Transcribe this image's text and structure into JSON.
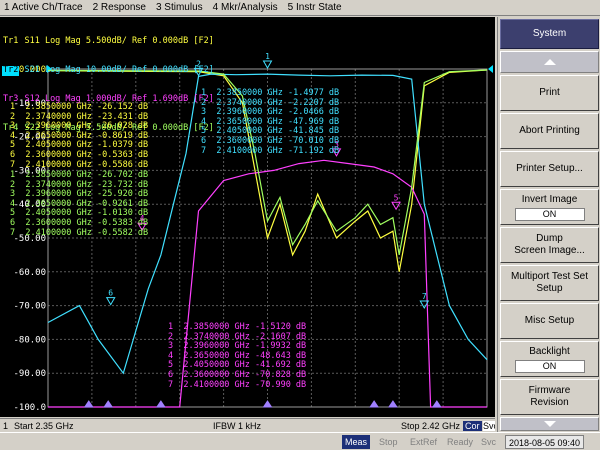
{
  "menu": [
    {
      "num": "1",
      "label": "Active Ch/Trace"
    },
    {
      "num": "2",
      "label": "Response"
    },
    {
      "num": "3",
      "label": "Stimulus"
    },
    {
      "num": "4",
      "label": "Mkr/Analysis"
    },
    {
      "num": "5",
      "label": "Instr State"
    }
  ],
  "traces": [
    {
      "id": "Tr1",
      "text": " S11 Log Mag 5.500dB/ Ref 0.000dB [F2]",
      "color": "#ffff40",
      "active": false
    },
    {
      "id": "Tr2",
      "text": " S21 Log Mag 10.00dB/ Ref 0.000dB [F2]",
      "color": "#40e0ff",
      "active": true
    },
    {
      "id": "Tr3",
      "text": " S12 Log Mag 1.000dB/ Ref 1.690dB [F2]",
      "color": "#ff40ff",
      "active": false
    },
    {
      "id": "Tr4",
      "text": " S22 Log Mag 5.500dB/ Ref 0.000dB [F2]",
      "color": "#a0ff60",
      "active": false
    }
  ],
  "chart_data": {
    "type": "line",
    "x_start_ghz": 2.35,
    "x_stop_ghz": 2.42,
    "ylim": [
      -100,
      0
    ],
    "y_ticks": [
      "0.000",
      "-10.00",
      "-20.00",
      "-30.00",
      "-40.00",
      "-50.00",
      "-60.00",
      "-70.00",
      "-80.00",
      "-90.00",
      "-100.0"
    ],
    "grid": true,
    "series": [
      {
        "name": "Tr1",
        "color": "#ffff40",
        "x": [
          2.35,
          2.374,
          2.378,
          2.381,
          2.383,
          2.385,
          2.387,
          2.389,
          2.391,
          2.393,
          2.396,
          2.399,
          2.401,
          2.403,
          2.405,
          2.406,
          2.408,
          2.41,
          2.414,
          2.42
        ],
        "y": [
          -0.5,
          -0.8,
          -2,
          -10,
          -30,
          -50,
          -40,
          -55,
          -48,
          -37,
          -50,
          -45,
          -42,
          -50,
          -48,
          -60,
          -40,
          -5,
          -1,
          -0.3
        ]
      },
      {
        "name": "Tr2",
        "color": "#40e0ff",
        "x": [
          2.35,
          2.355,
          2.358,
          2.362,
          2.366,
          2.368,
          2.37,
          2.372,
          2.374,
          2.376,
          2.38,
          2.385,
          2.39,
          2.395,
          2.4,
          2.405,
          2.408,
          2.41,
          2.412,
          2.414,
          2.417,
          2.42
        ],
        "y": [
          -75,
          -70,
          -80,
          -90,
          -65,
          -55,
          -40,
          -25,
          -2.2,
          -1.5,
          -1.7,
          -1.5,
          -1.8,
          -2.0,
          -1.8,
          -1.9,
          -3,
          -40,
          -55,
          -70,
          -80,
          -86
        ]
      },
      {
        "name": "Tr3",
        "color": "#ff40ff",
        "x": [
          2.35,
          2.37,
          2.371,
          2.374,
          2.378,
          2.382,
          2.386,
          2.39,
          2.394,
          2.398,
          2.402,
          2.405,
          2.408,
          2.41,
          2.411,
          2.42
        ],
        "y": [
          -100,
          -100,
          -100,
          -42,
          -33,
          -31,
          -30,
          -28,
          -27,
          -28,
          -29,
          -31,
          -35,
          -43,
          -100,
          -100
        ]
      },
      {
        "name": "Tr4",
        "color": "#a0ff60",
        "x": [
          2.35,
          2.374,
          2.378,
          2.381,
          2.383,
          2.385,
          2.387,
          2.389,
          2.391,
          2.393,
          2.396,
          2.399,
          2.401,
          2.403,
          2.405,
          2.406,
          2.408,
          2.41,
          2.414,
          2.42
        ],
        "y": [
          -0.4,
          -0.6,
          -1.5,
          -8,
          -25,
          -45,
          -38,
          -52,
          -46,
          -39,
          -48,
          -44,
          -40,
          -46,
          -44,
          -55,
          -35,
          -4,
          -0.8,
          -0.3
        ]
      }
    ],
    "marker_labels": [
      {
        "text": "1",
        "x": 2.385,
        "y": 0,
        "color": "#40e0ff"
      },
      {
        "text": "2",
        "x": 2.374,
        "y": -2.2,
        "color": "#40e0ff"
      },
      {
        "text": "6",
        "x": 2.36,
        "y": -70,
        "color": "#40e0ff"
      },
      {
        "text": "7",
        "x": 2.41,
        "y": -71,
        "color": "#40e0ff"
      },
      {
        "text": "3",
        "x": 2.396,
        "y": -26,
        "color": "#ff40ff"
      },
      {
        "text": "4",
        "x": 2.365,
        "y": -48,
        "color": "#ff40ff"
      },
      {
        "text": "5",
        "x": 2.4055,
        "y": -41.8,
        "color": "#ff40ff"
      }
    ]
  },
  "markers_s11": [
    {
      "n": "1",
      "f": "2.3850000 GHz",
      "v": "-26.152 dB"
    },
    {
      "n": "2",
      "f": "2.3740000 GHz",
      "v": "-23.431 dB"
    },
    {
      "n": "3",
      "f": "2.3960000 GHz",
      "v": "-26.028 dB"
    },
    {
      "n": "4",
      "f": "2.3650000 GHz",
      "v": "-0.8619 dB"
    },
    {
      "n": "5",
      "f": "2.4050000 GHz",
      "v": "-1.0379 dB"
    },
    {
      "n": "6",
      "f": "2.3600000 GHz",
      "v": "-0.5363 dB"
    },
    {
      "n": "7",
      "f": "2.4100000 GHz",
      "v": "-0.5586 dB"
    }
  ],
  "markers_s22": [
    {
      "n": "1",
      "f": "2.3850000 GHz",
      "v": "-26.702 dB"
    },
    {
      "n": "2",
      "f": "2.3740000 GHz",
      "v": "-23.732 dB"
    },
    {
      "n": "3",
      "f": "2.3960000 GHz",
      "v": "-25.920 dB"
    },
    {
      "n": "4",
      "f": "2.3650000 GHz",
      "v": "-0.9261 dB"
    },
    {
      "n": "5",
      "f": "2.4050000 GHz",
      "v": "-1.0130 dB"
    },
    {
      "n": "6",
      "f": "2.3600000 GHz",
      "v": "-0.5383 dB"
    },
    {
      "n": "7",
      "f": "2.4100000 GHz",
      "v": "-0.5582 dB"
    }
  ],
  "markers_s21": [
    {
      "n": "1",
      "f": "2.3850000 GHz",
      "v": "-1.4977 dB"
    },
    {
      "n": "2",
      "f": "2.3740000 GHz",
      "v": "-2.2207 dB"
    },
    {
      "n": "3",
      "f": "2.3960000 GHz",
      "v": "-2.0466 dB"
    },
    {
      "n": "4",
      "f": "2.3650000 GHz",
      "v": "-47.969 dB"
    },
    {
      "n": "5",
      "f": "2.4050000 GHz",
      "v": "-41.845 dB"
    },
    {
      "n": "6",
      "f": "2.3600000 GHz",
      "v": "-70.010 dB"
    },
    {
      "n": "7",
      "f": "2.4100000 GHz",
      "v": "-71.192 dB"
    }
  ],
  "markers_s12": [
    {
      "n": "1",
      "f": "2.3850000 GHz",
      "v": "-1.5120 dB"
    },
    {
      "n": "2",
      "f": "2.3740000 GHz",
      "v": "-2.1607 dB"
    },
    {
      "n": "3",
      "f": "2.3960000 GHz",
      "v": "-1.9932 dB"
    },
    {
      "n": "4",
      "f": "2.3650000 GHz",
      "v": "-48.643 dB"
    },
    {
      "n": "5",
      "f": "2.4050000 GHz",
      "v": "-41.692 dB"
    },
    {
      "n": "6",
      "f": "2.3600000 GHz",
      "v": "-70.828 dB"
    },
    {
      "n": "7",
      "f": "2.4100000 GHz",
      "v": "-70.990 dB"
    }
  ],
  "status": {
    "channel": "1",
    "start": "Start 2.35 GHz",
    "ifbw": "IFBW 1 kHz",
    "stop": "Stop 2.42 GHz",
    "svc": "Svc",
    "cor": "Cor"
  },
  "bottom": {
    "meas": "Meas",
    "stop": "Stop",
    "extref": "ExtRef",
    "ready": "Ready",
    "svc": "Svc",
    "datetime": "2018-08-05 09:40"
  },
  "softkeys": {
    "title": "System",
    "print": "Print",
    "abort": "Abort Printing",
    "printer_setup": "Printer Setup...",
    "invert_label": "Invert Image",
    "invert_val": "ON",
    "dump_1": "Dump",
    "dump_2": "Screen Image...",
    "multiport_1": "Multiport Test Set",
    "multiport_2": "Setup",
    "misc": "Misc Setup",
    "backlight_label": "Backlight",
    "backlight_val": "ON",
    "firmware_1": "Firmware",
    "firmware_2": "Revision"
  }
}
